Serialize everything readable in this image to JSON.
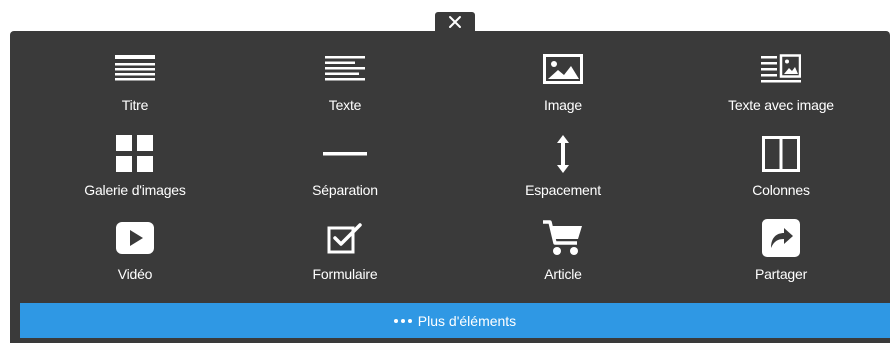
{
  "close": {
    "icon": "close-icon"
  },
  "items": [
    {
      "label": "Titre",
      "icon": "title-lines-icon"
    },
    {
      "label": "Texte",
      "icon": "text-lines-icon"
    },
    {
      "label": "Image",
      "icon": "image-icon"
    },
    {
      "label": "Texte avec image",
      "icon": "text-with-image-icon"
    },
    {
      "label": "Galerie d'images",
      "icon": "gallery-grid-icon"
    },
    {
      "label": "Séparation",
      "icon": "separator-line-icon"
    },
    {
      "label": "Espacement",
      "icon": "spacing-arrows-icon"
    },
    {
      "label": "Colonnes",
      "icon": "columns-icon"
    },
    {
      "label": "Vidéo",
      "icon": "video-play-icon"
    },
    {
      "label": "Formulaire",
      "icon": "form-checkbox-icon"
    },
    {
      "label": "Article",
      "icon": "shopping-cart-icon"
    },
    {
      "label": "Partager",
      "icon": "share-arrow-icon"
    }
  ],
  "more": {
    "label": "Plus d'éléments",
    "icon": "more-dots-icon"
  },
  "colors": {
    "panel": "#3a3a3a",
    "accent": "#2f98e4",
    "icon": "#ffffff"
  }
}
